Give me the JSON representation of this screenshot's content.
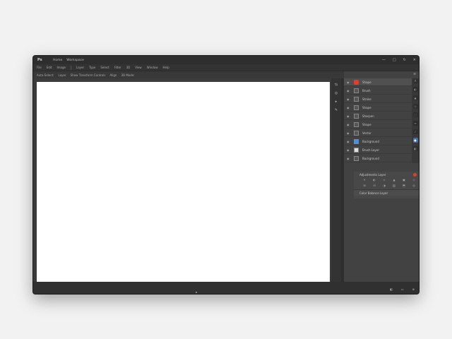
{
  "titlebar": {
    "logo": "Ps",
    "menu": [
      "Home",
      "Workspace"
    ],
    "controls": [
      "—",
      "□",
      "↻",
      "✕"
    ]
  },
  "menubar": [
    "File",
    "Edit",
    "Image",
    "Layer",
    "Type",
    "Select",
    "Filter",
    "3D",
    "View",
    "Window",
    "Help"
  ],
  "optbar": [
    "Auto-Select:",
    "Layer",
    "Show Transform Controls",
    "Align",
    "3D Mode:"
  ],
  "toolstrip": [
    "⇆",
    "◎",
    "▸",
    "✎"
  ],
  "panel": {
    "top_icon": "≡",
    "layers": [
      {
        "eye": "◉",
        "thumb": "red",
        "name": "Shape"
      },
      {
        "eye": "◉",
        "thumb": "gray",
        "name": "Brush"
      },
      {
        "eye": "◉",
        "thumb": "gray",
        "name": "Stroke"
      },
      {
        "eye": "◉",
        "thumb": "gray",
        "name": "Shape"
      },
      {
        "eye": "◉",
        "thumb": "gray",
        "name": "Sharpen"
      },
      {
        "eye": "◉",
        "thumb": "gray",
        "name": "Shape"
      },
      {
        "eye": "◉",
        "thumb": "gray",
        "name": "Vector"
      },
      {
        "eye": "◉",
        "thumb": "blue",
        "name": "Background"
      },
      {
        "eye": "◉",
        "thumb": "light",
        "name": "Brush Layer"
      },
      {
        "eye": "◉",
        "thumb": "gray",
        "name": "Background"
      }
    ],
    "side_icons": [
      "A",
      "◐",
      "▲",
      "◇",
      "⬚",
      "≡",
      "♪",
      "●",
      "◧"
    ],
    "adjustments": {
      "title": "Adjustments Layer",
      "row1": [
        "☀",
        "◐",
        "≈",
        "▲",
        "▣",
        "◇"
      ],
      "row2": [
        "⊞",
        "⊟",
        "◑",
        "▧",
        "⬒",
        "◎"
      ],
      "footer": "Color Balance Layer"
    }
  },
  "status": {
    "icons": [
      "◧",
      "▭",
      "⊕"
    ]
  }
}
